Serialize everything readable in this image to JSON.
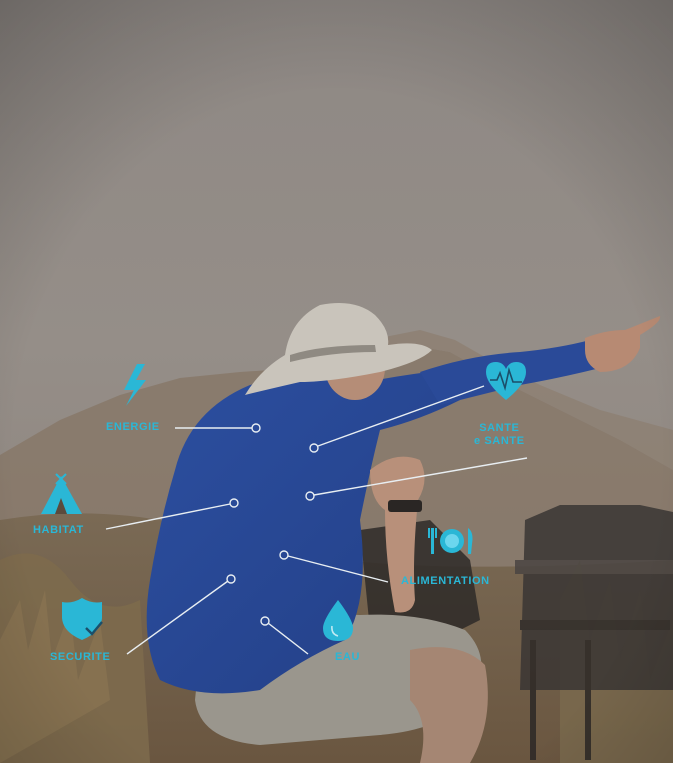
{
  "colors": {
    "accent": "#2ab7d6",
    "line": "#e8eef2"
  },
  "infographic": {
    "energie": {
      "label": "ENERGIE",
      "icon": "lightning-bolt-icon"
    },
    "sante": {
      "label_line1": "SANTE",
      "label_line2": "e SANTE",
      "icon": "heart-pulse-icon"
    },
    "habitat": {
      "label": "HABITAT",
      "icon": "tent-icon"
    },
    "alimentation": {
      "label": "ALIMENTATION",
      "icon": "plate-cutlery-icon"
    },
    "securite": {
      "label": "SECURITE",
      "icon": "shield-check-icon"
    },
    "eau": {
      "label": "EAU",
      "icon": "water-drop-icon"
    }
  }
}
